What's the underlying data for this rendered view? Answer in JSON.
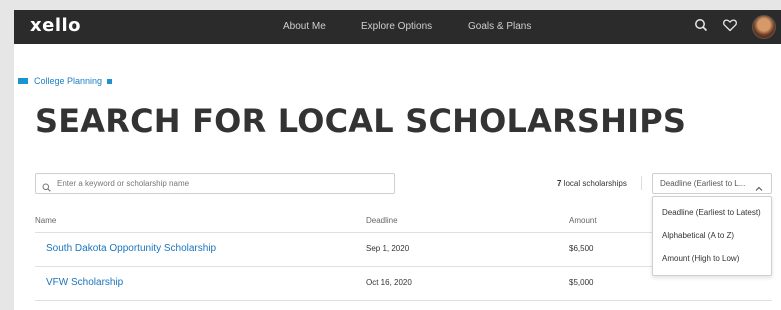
{
  "app": {
    "logo": "xello"
  },
  "nav": {
    "items": [
      "About Me",
      "Explore Options",
      "Goals & Plans"
    ]
  },
  "header_icons": [
    "search-icon",
    "heart-icon",
    "avatar"
  ],
  "breadcrumb": {
    "label": "College Planning"
  },
  "page": {
    "title": "SEARCH FOR LOCAL SCHOLARSHIPS"
  },
  "search": {
    "placeholder": "Enter a keyword or scholarship name",
    "value": ""
  },
  "results": {
    "count": "7",
    "count_label": "local scholarships"
  },
  "sort": {
    "selected": "Deadline (Earliest to L...",
    "options": [
      "Deadline (Earliest to Latest)",
      "Alphabetical (A to Z)",
      "Amount (High to Low)"
    ]
  },
  "table": {
    "headers": [
      "Name",
      "Deadline",
      "Amount"
    ],
    "rows": [
      {
        "name": "South Dakota Opportunity Scholarship",
        "deadline": "Sep 1, 2020",
        "amount": "$6,500"
      },
      {
        "name": "VFW Scholarship",
        "deadline": "Oct 16, 2020",
        "amount": "$5,000"
      }
    ]
  },
  "colors": {
    "accent": "#1b75bc",
    "topbar": "#2b2b2b",
    "title": "#333333"
  }
}
